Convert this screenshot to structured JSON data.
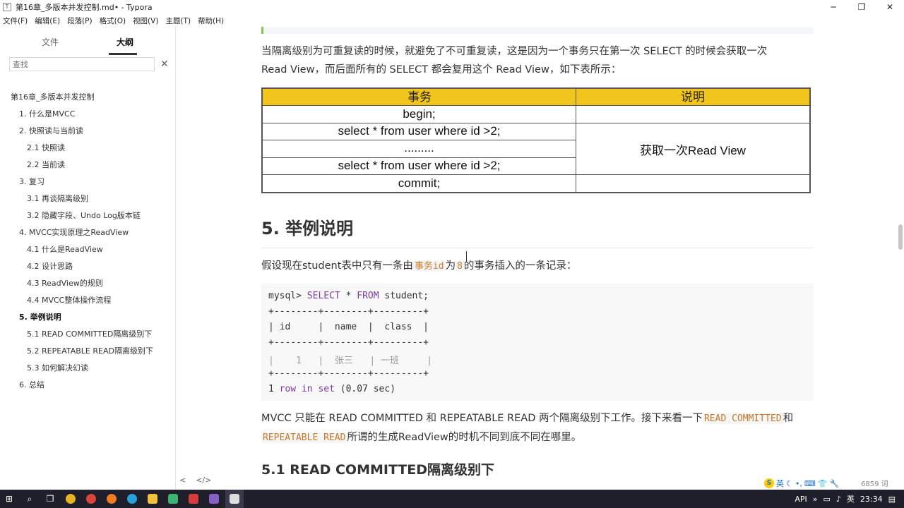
{
  "window": {
    "title": "第16章_多版本并发控制.md• - Typora",
    "app_icon": "T",
    "controls": [
      "─",
      "❐",
      "✕"
    ]
  },
  "menu": [
    "文件(F)",
    "编辑(E)",
    "段落(P)",
    "格式(O)",
    "视图(V)",
    "主题(T)",
    "帮助(H)"
  ],
  "sidebar": {
    "tabs": [
      "文件",
      "大纲"
    ],
    "active_tab": "大纲",
    "search_placeholder": "查找",
    "outline": [
      {
        "label": "第16章_多版本并发控制",
        "level": 1
      },
      {
        "label": "1. 什么是MVCC",
        "level": 2
      },
      {
        "label": "2. 快照读与当前读",
        "level": 2
      },
      {
        "label": "2.1 快照读",
        "level": 3
      },
      {
        "label": "2.2 当前读",
        "level": 3
      },
      {
        "label": "3. 复习",
        "level": 2
      },
      {
        "label": "3.1 再谈隔离级别",
        "level": 3
      },
      {
        "label": "3.2 隐藏字段、Undo Log版本链",
        "level": 3
      },
      {
        "label": "4. MVCC实现原理之ReadView",
        "level": 2
      },
      {
        "label": "4.1 什么是ReadView",
        "level": 3
      },
      {
        "label": "4.2 设计思路",
        "level": 3
      },
      {
        "label": "4.3 ReadView的规则",
        "level": 3
      },
      {
        "label": "4.4 MVCC整体操作流程",
        "level": 3
      },
      {
        "label": "5. 举例说明",
        "level": 2,
        "active": true
      },
      {
        "label": "5.1 READ COMMITTED隔离级别下",
        "level": 3
      },
      {
        "label": "5.2 REPEATABLE READ隔离级别下",
        "level": 3
      },
      {
        "label": "5.3 如何解决幻读",
        "level": 3
      },
      {
        "label": "6. 总结",
        "level": 2
      }
    ],
    "bottom_icons": [
      "<",
      "</>"
    ]
  },
  "editor": {
    "para1_line1": "当隔离级别为可重复读的时候，就避免了不可重复读，这是因为一个事务只在第一次 SELECT 的时候会获取一次",
    "para1_line2": "Read View，而后面所有的 SELECT 都会复用这个 Read View，如下表所示：",
    "table": {
      "headers": [
        "事务",
        "说明"
      ],
      "rows": [
        "begin;",
        "select * from user where id >2;",
        ".........",
        "select * from user where id >2;",
        "commit;"
      ],
      "merged_note": "获取一次Read View"
    },
    "h2": "5. 举例说明",
    "para2_before": "假设现在student表中只有一条由",
    "para2_code1": "事务id",
    "para2_mid": "为",
    "para2_code2": "8",
    "para2_after": "的事务插入的一条记录：",
    "code": {
      "prompt": "mysql> ",
      "select_kw": "SELECT",
      "star": " * ",
      "from_kw": "FROM",
      "table_name": " student;",
      "border": "+--------+--------+---------+",
      "header_row": "| id     |  name  |  class  |",
      "data_row": "|    1   |  张三   | 一班     |",
      "result_1": "1 ",
      "result_row": "row",
      "result_in": " in ",
      "result_set": "set",
      "result_time": " (0.07 sec)"
    },
    "para3_line1_a": "MVCC 只能在 READ COMMITTED 和 REPEATABLE  READ 两个隔离级别下工作。接下来看一下",
    "para3_code1": "READ COMMITTED",
    "para3_line1_b": "和",
    "para3_code2": "REPEATABLE READ",
    "para3_line2": "所谓的生成ReadView的时机不同到底不同在哪里。",
    "h3": "5.1 READ COMMITTED隔离级别下"
  },
  "status": {
    "word_count": "6859 词",
    "ime": [
      "英",
      "☾",
      "•,",
      "⌨",
      "👕",
      "🔧"
    ]
  },
  "taskbar": {
    "icons": [
      "windows-start",
      "search",
      "task-view",
      "chrome",
      "chrome-2",
      "firefox",
      "edge",
      "file-explorer",
      "green-app",
      "red-app",
      "visual-studio",
      "typora"
    ],
    "tray": {
      "api": "API",
      "chevron": "»",
      "lang": "英",
      "time": "23:34"
    }
  }
}
